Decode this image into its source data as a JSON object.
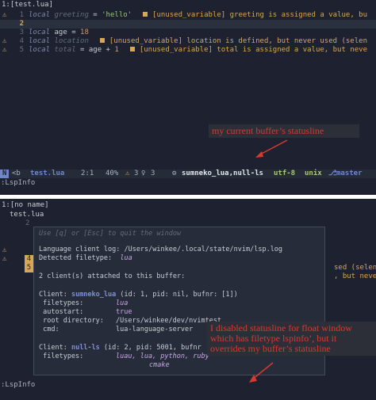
{
  "top": {
    "tab_title": "1:[test.lua]",
    "lines": [
      {
        "num": "1",
        "parts": [
          [
            "local ",
            "kw"
          ],
          [
            "greeting",
            "unused"
          ],
          [
            " = ",
            ""
          ],
          [
            "'hello'",
            "str"
          ]
        ],
        "diag": "[unused_variable] greeting is assigned a value, bu"
      },
      {
        "num": "2",
        "parts": []
      },
      {
        "num": "3",
        "parts": [
          [
            "local ",
            "kw"
          ],
          [
            "age = ",
            ""
          ],
          [
            "18",
            "num"
          ]
        ]
      },
      {
        "num": "4",
        "parts": [
          [
            "local ",
            "kw"
          ],
          [
            "location",
            "unused"
          ]
        ],
        "diag": "[unused_variable] location is defined, but never used (selen"
      },
      {
        "num": "5",
        "parts": [
          [
            "local ",
            "kw"
          ],
          [
            "total",
            "unused"
          ],
          [
            " = age + ",
            ""
          ],
          [
            "1",
            "num"
          ]
        ],
        "diag": "[unused_variable] total is assigned a value, but neve"
      }
    ],
    "statusline": {
      "mode": "N",
      "buf": "<b",
      "file": "test.lua",
      "pos": "2:1",
      "pct": "40%",
      "warn_count": "3",
      "hint_count": "3",
      "lsp": "sumneko_lua,null-ls",
      "encoding": "utf-8",
      "format": "unix",
      "branch": "master"
    },
    "cmdline": ":LspInfo",
    "annotation": "my current buffer’s statusline"
  },
  "bottom": {
    "tab_title": "1:[no name]",
    "behind_file": "test.lua",
    "behind_num": "2",
    "behind_right_4": "sed (selen",
    "behind_right_5": ", but neve",
    "float": {
      "hint": "Use [q] or [Esc] to quit the window",
      "log_line": "Language client log: /Users/winkee/.local/state/nvim/lsp.log",
      "filetype_label": "Detected filetype:",
      "filetype_value": "lua",
      "attached": "2 client(s) attached to this buffer:",
      "client1_prefix": "Client: ",
      "client1_name": "sumneko_lua",
      "client1_suffix": " (id: 1, pid: nil, bufnr: [1])",
      "client1_filetypes_label": " filetypes:",
      "client1_filetypes_value": "lua",
      "client1_autostart_label": " autostart:",
      "client1_autostart_value": "true",
      "client1_root_label": " root directory:",
      "client1_root_value": "/Users/winkee/dev/nvimtest",
      "client1_cmd_label": " cmd:",
      "client1_cmd_value": "lua-language-server",
      "client2_prefix": "Client: ",
      "client2_name": "null-ls",
      "client2_suffix": " (id: 2, pid: 5001, bufnr",
      "client2_filetypes_label": " filetypes:",
      "client2_filetypes_value": "luau, lua, python, ruby",
      "client2_filetypes_value2": "cmake"
    },
    "cmdline": ":LspInfo",
    "annotation_lines": [
      "I disabled statusline for float window",
      "which has filetype lspinfo’, but it",
      "overrides my buffer’s statusline"
    ]
  },
  "colors": {
    "background": "#1e2230",
    "annotation_text": "#d63a2f",
    "warning": "#d8a657",
    "mode_bg": "#6f87c9"
  }
}
